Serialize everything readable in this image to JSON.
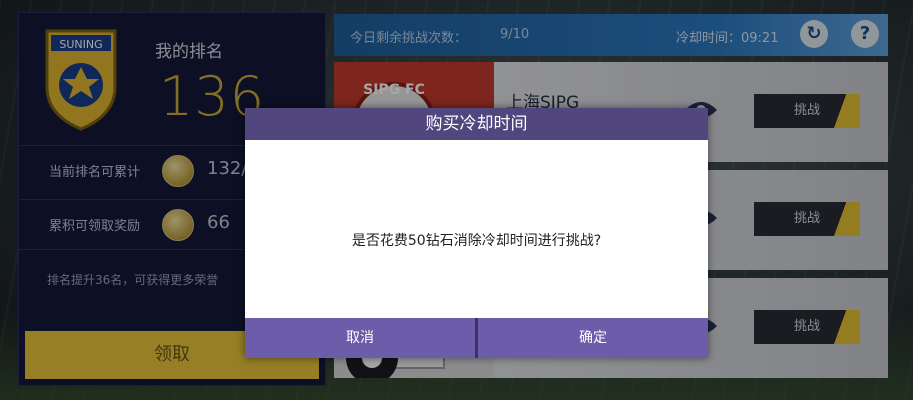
{
  "left_panel": {
    "crest_text": "SUNING",
    "rank_title": "我的排名",
    "rank_value": "136",
    "stats": [
      {
        "label": "当前排名可累计",
        "value": "132/"
      },
      {
        "label": "累积可领取奖励",
        "value": "66"
      }
    ],
    "promo_text": "排名提升36名，可获得更多荣誉",
    "help_icon": "?",
    "claim_label": "领取"
  },
  "top_bar": {
    "challenges_label": "今日剩余挑战次数：",
    "challenges_count": "9/10",
    "cooldown_label": "冷却时间：09:21",
    "refresh_icon": "↻",
    "help_icon": "?"
  },
  "opponents": [
    {
      "name": "上海SIPG",
      "badge_text": "SIPG FC",
      "challenge_label": "挑战"
    },
    {
      "name": "",
      "badge_text": "",
      "challenge_label": "挑战"
    },
    {
      "name": "",
      "badge_text": "",
      "challenge_label": "挑战"
    }
  ],
  "modal": {
    "title": "购买冷却时间",
    "message": "是否花费50钻石消除冷却时间进行挑战?",
    "cancel_label": "取消",
    "confirm_label": "确定"
  },
  "colors": {
    "panel_bg": "#151a3a",
    "rank_gold": "#c9a93a",
    "claim_yellow": "#e6c43a",
    "top_bar_blue": "#2c79bf",
    "modal_header": "#51467e",
    "modal_button": "#6c5caa"
  }
}
